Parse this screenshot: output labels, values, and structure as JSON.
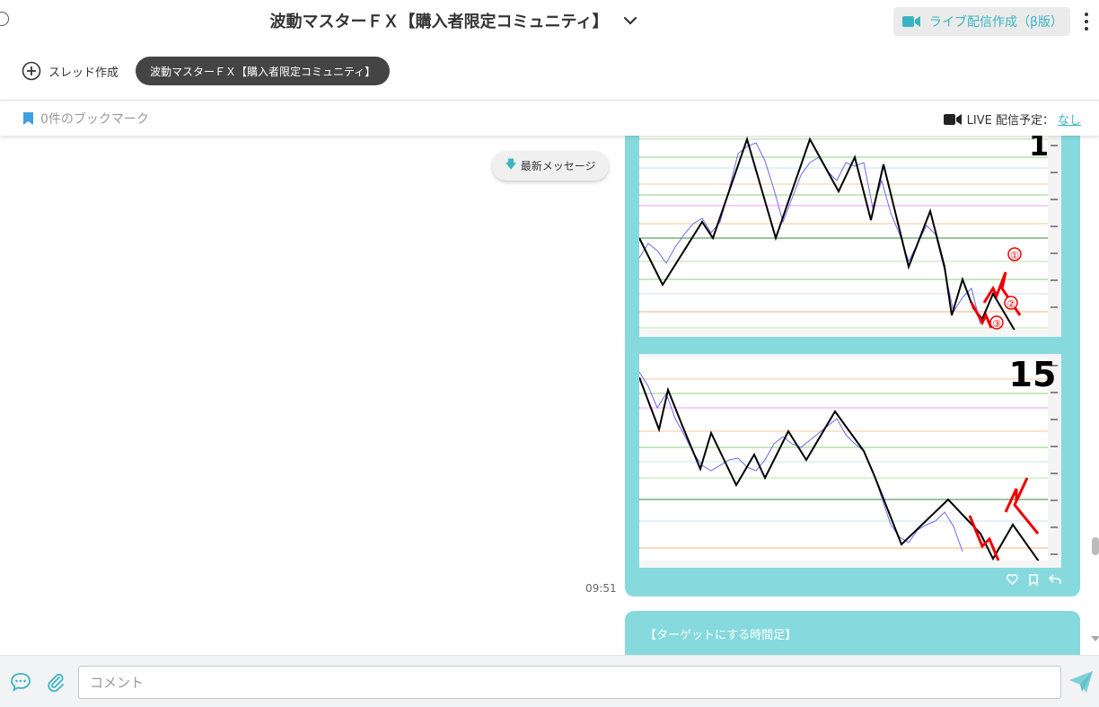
{
  "header": {
    "title": "波動マスターＦＸ【購入者限定コミュニティ】",
    "live_button": "ライブ配信作成（β版）"
  },
  "threads": {
    "new_thread": "スレッド作成",
    "active_chip": "波動マスターＦＸ【購入者限定コミュニティ】"
  },
  "bookmarks": {
    "label": "0件のブックマーク",
    "live_schedule_label": "LIVE 配信予定：",
    "live_schedule_value": "なし"
  },
  "messages": {
    "latest_button": "最新メッセージ",
    "timestamp": "09:51",
    "chart1_label": "1",
    "chart2_label": "15",
    "annotations": [
      "①",
      "②",
      "③"
    ],
    "next_message_text": "【ターゲットにする時間足】"
  },
  "composer": {
    "placeholder": "コメント"
  },
  "colors": {
    "accent": "#3ab4c3",
    "bubble": "#86dadd",
    "chip": "#444444"
  },
  "icons": [
    "video-camera-icon",
    "chevron-down-icon",
    "kebab-menu-icon",
    "plus-circle-icon",
    "bookmark-icon",
    "arrow-down-icon",
    "heart-icon",
    "bookmark-outline-icon",
    "reply-icon",
    "chat-bubble-icon",
    "paperclip-icon",
    "send-icon"
  ]
}
